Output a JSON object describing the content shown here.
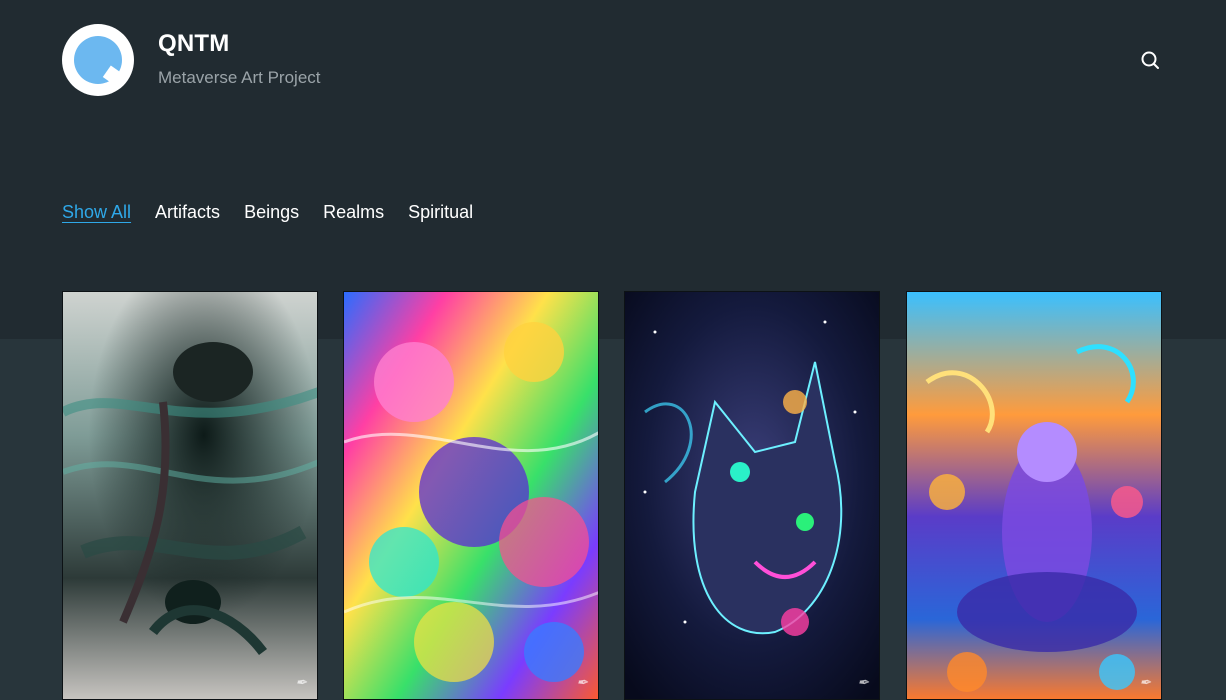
{
  "site": {
    "title": "QNTM",
    "tagline": "Metaverse Art Project"
  },
  "header": {
    "search_icon": "search-icon"
  },
  "filters": [
    {
      "label": "Show All",
      "active": true
    },
    {
      "label": "Artifacts",
      "active": false
    },
    {
      "label": "Beings",
      "active": false
    },
    {
      "label": "Realms",
      "active": false
    },
    {
      "label": "Spiritual",
      "active": false
    }
  ],
  "colors": {
    "header_bg": "#212b31",
    "page_bg": "#28353b",
    "accent": "#2fa8e8",
    "logo_blue": "#6cb8f0"
  },
  "gallery": [
    {
      "name": "artwork-creature-smoke",
      "theme": "dark teal smoky creature"
    },
    {
      "name": "artwork-psychedelic-abstract",
      "theme": "neon rainbow organic abstract"
    },
    {
      "name": "artwork-cosmic-cat",
      "theme": "cosmic neon cat"
    },
    {
      "name": "artwork-ocean-being",
      "theme": "vivid underwater being"
    }
  ]
}
